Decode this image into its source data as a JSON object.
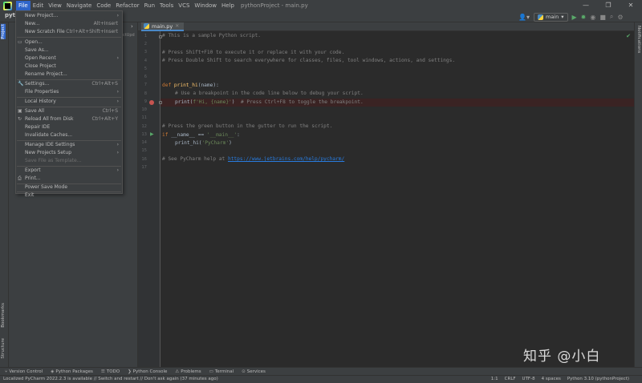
{
  "app": {
    "window_title": "pythonProject - main.py",
    "project_name": "pyth"
  },
  "menu": [
    {
      "label": "File",
      "active": true
    },
    {
      "label": "Edit"
    },
    {
      "label": "View"
    },
    {
      "label": "Navigate"
    },
    {
      "label": "Code"
    },
    {
      "label": "Refactor"
    },
    {
      "label": "Run"
    },
    {
      "label": "Tools"
    },
    {
      "label": "VCS"
    },
    {
      "label": "Window"
    },
    {
      "label": "Help"
    }
  ],
  "window_controls": {
    "minimize": "—",
    "maximize": "❐",
    "close": "✕"
  },
  "toolbar": {
    "user_icon": "user-icon",
    "run_config_label": "main",
    "run_icon": "run-icon",
    "debug_icon": "debug-icon"
  },
  "left_strip": {
    "project_tab": "Project",
    "bookmarks_tab": "Bookmarks",
    "structure_tab": "Structure"
  },
  "right_strip": {
    "notifications_tab": "Notifications"
  },
  "project_panel": {
    "hint": "ctUpd"
  },
  "file_menu": {
    "items": [
      {
        "label": "New Project...",
        "shortcut": ""
      },
      {
        "label": "New...",
        "shortcut": "Alt+Insert"
      },
      {
        "label": "New Scratch File",
        "shortcut": "Ctrl+Alt+Shift+Insert"
      },
      {
        "label": "Open...",
        "shortcut": ""
      },
      {
        "label": "Save As...",
        "shortcut": ""
      },
      {
        "label": "Open Recent",
        "shortcut": ""
      },
      {
        "label": "Close Project",
        "shortcut": ""
      },
      {
        "label": "Rename Project...",
        "shortcut": ""
      },
      {
        "label": "Settings...",
        "shortcut": "Ctrl+Alt+S"
      },
      {
        "label": "File Properties",
        "shortcut": ""
      },
      {
        "label": "Local History",
        "shortcut": ""
      },
      {
        "label": "Save All",
        "shortcut": "Ctrl+S"
      },
      {
        "label": "Reload All from Disk",
        "shortcut": "Ctrl+Alt+Y"
      },
      {
        "label": "Repair IDE",
        "shortcut": ""
      },
      {
        "label": "Invalidate Caches...",
        "shortcut": ""
      },
      {
        "label": "Manage IDE Settings",
        "shortcut": ""
      },
      {
        "label": "New Projects Setup",
        "shortcut": ""
      },
      {
        "label": "Save File as Template...",
        "shortcut": ""
      },
      {
        "label": "Export",
        "shortcut": ""
      },
      {
        "label": "Print...",
        "shortcut": ""
      },
      {
        "label": "Power Save Mode",
        "shortcut": ""
      },
      {
        "label": "Exit",
        "shortcut": ""
      }
    ]
  },
  "editor": {
    "tab_label": "main.py",
    "line_numbers": [
      "1",
      "2",
      "3",
      "4",
      "5",
      "6",
      "7",
      "8",
      "9",
      "10",
      "11",
      "12",
      "13",
      "14",
      "15",
      "16",
      "17"
    ],
    "lines": {
      "l1": "# This is a sample Python script.",
      "l3": "# Press Shift+F10 to execute it or replace it with your code.",
      "l4": "# Press Double Shift to search everywhere for classes, files, tool windows, actions, and settings.",
      "l7_kw": "def ",
      "l7_fn": "print_hi",
      "l7_rest": "(name):",
      "l8": "# Use a breakpoint in the code line below to debug your script.",
      "l9_a": "print(",
      "l9_str": "f'Hi, {name}'",
      "l9_b": ")  ",
      "l9_com": "# Press Ctrl+F8 to toggle the breakpoint.",
      "l12": "# Press the green button in the gutter to run the script.",
      "l13_kw": "if ",
      "l13_a": "__name__ == ",
      "l13_str": "'__main__'",
      "l13_b": ":",
      "l14_a": "print_hi(",
      "l14_str": "'PyCharm'",
      "l14_b": ")",
      "l16_com": "# See PyCharm help at ",
      "l16_link": "https://www.jetbrains.com/help/pycharm/"
    }
  },
  "bottom_tools": [
    {
      "label": "Version Control",
      "icon": "branch-icon"
    },
    {
      "label": "Python Packages",
      "icon": "package-icon"
    },
    {
      "label": "TODO",
      "icon": "list-icon"
    },
    {
      "label": "Python Console",
      "icon": "console-icon"
    },
    {
      "label": "Problems",
      "icon": "warning-icon"
    },
    {
      "label": "Terminal",
      "icon": "terminal-icon"
    },
    {
      "label": "Services",
      "icon": "services-icon"
    }
  ],
  "status": {
    "message": "Localized PyCharm 2022.2.3 is available // Switch and restart // Don't ask again (37 minutes ago)",
    "position": "1:1",
    "line_sep": "CRLF",
    "encoding": "UTF-8",
    "indent": "4 spaces",
    "interpreter": "Python 3.10 (pythonProject)"
  },
  "watermark": "知乎 @小白",
  "colors": {
    "accent": "#2f65ca",
    "breakpoint": "#c75450",
    "run": "#59a869"
  }
}
